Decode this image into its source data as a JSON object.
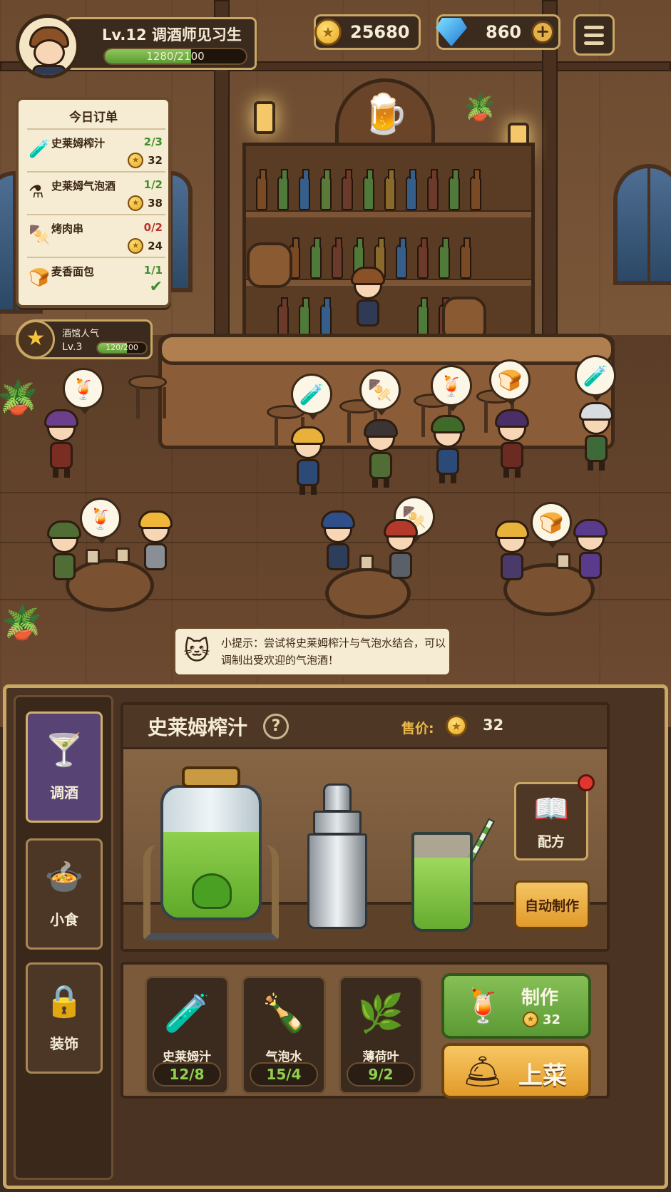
{
  "player": {
    "level_title": "Lv.12  调酒师见习生",
    "xp_text": "1280/2100",
    "xp_fraction": 0.61
  },
  "currency": {
    "gold": "25680",
    "gems": "860",
    "add_symbol": "+"
  },
  "orders": {
    "title": "今日订单",
    "items": [
      {
        "name": "史莱姆榨汁",
        "progress": "2/3",
        "reward": "32",
        "icon": "green-potion-icon",
        "progress_color": "#3f8e2c"
      },
      {
        "name": "史莱姆气泡酒",
        "progress": "1/2",
        "reward": "38",
        "icon": "blue-potion-icon",
        "progress_color": "#3f8e2c"
      },
      {
        "name": "烤肉串",
        "progress": "0/2",
        "reward": "24",
        "icon": "skewer-icon",
        "progress_color": "#b8312a"
      },
      {
        "name": "麦香面包",
        "progress": "1/1",
        "reward": "",
        "icon": "bread-icon",
        "progress_color": "#3f8e2c"
      }
    ]
  },
  "popularity": {
    "title": "酒馆人气",
    "level": "Lv.3",
    "progress_text": "120/200",
    "fraction": 0.6
  },
  "tip": {
    "text": "小提示：尝试将史莱姆榨汁与气泡水结合，可以调制出受欢迎的气泡酒！"
  },
  "tabs": [
    {
      "label": "调酒",
      "icon": "cocktail-icon",
      "glyph": "🍸",
      "active": true
    },
    {
      "label": "小食",
      "icon": "chef-hat-icon",
      "glyph": "🍲",
      "active": false
    },
    {
      "label": "装饰",
      "icon": "lock-icon",
      "glyph": "🔒",
      "active": false
    }
  ],
  "recipe": {
    "name": "史莱姆榨汁",
    "help": "?",
    "price_label": "售价:",
    "price": "32",
    "book_label": "配方",
    "auto_label": "自动制作"
  },
  "ingredients": [
    {
      "name": "史莱姆汁",
      "count": "12/8",
      "icon": "slime-flask-icon",
      "glyph": "🧪"
    },
    {
      "name": "气泡水",
      "count": "15/4",
      "icon": "soda-bottle-icon",
      "glyph": "🍾"
    },
    {
      "name": "薄荷叶",
      "count": "9/2",
      "icon": "mint-leaf-icon",
      "glyph": "🌿"
    }
  ],
  "actions": {
    "make_label": "制作",
    "make_cost": "32",
    "serve_label": "上菜"
  },
  "colors": {
    "accent_gold": "#c9a765",
    "panel_dark": "#3b2a1e",
    "green": "#5b9a34",
    "orange": "#e39a29",
    "active_tab": "#584474"
  }
}
